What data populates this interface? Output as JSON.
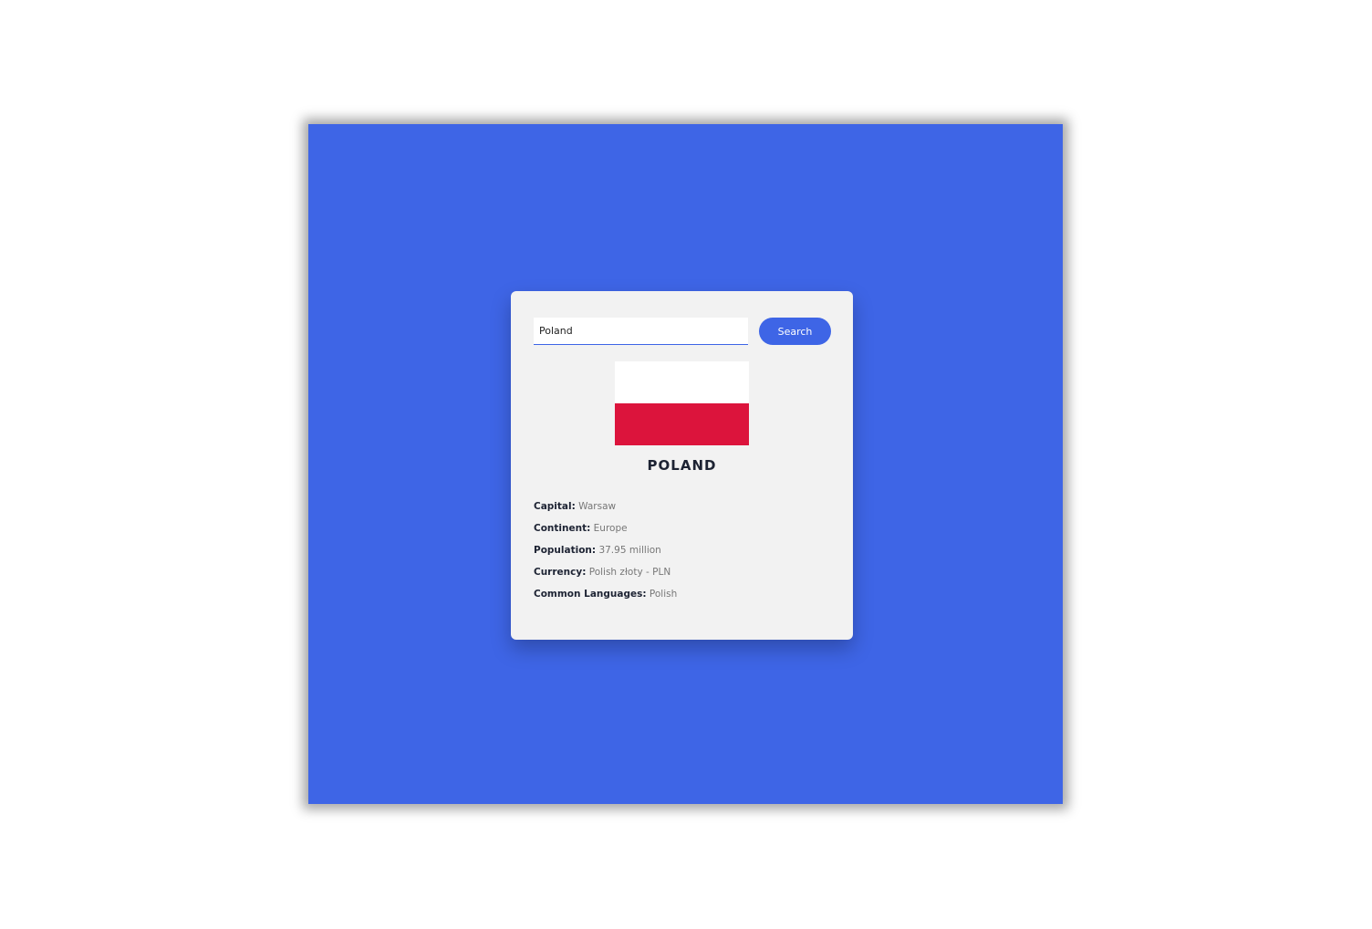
{
  "search": {
    "value": "Poland",
    "button_label": "Search"
  },
  "country": {
    "name": "POLAND",
    "flag_colors": [
      "#ffffff",
      "#dc143c"
    ]
  },
  "details": [
    {
      "label": "Capital:",
      "value": "Warsaw"
    },
    {
      "label": "Continent:",
      "value": "Europe"
    },
    {
      "label": "Population:",
      "value": "37.95 million"
    },
    {
      "label": "Currency:",
      "value": "Polish złoty - PLN"
    },
    {
      "label": "Common Languages:",
      "value": "Polish"
    }
  ],
  "colors": {
    "accent": "#3e65e6",
    "card": "#f2f2f2"
  }
}
